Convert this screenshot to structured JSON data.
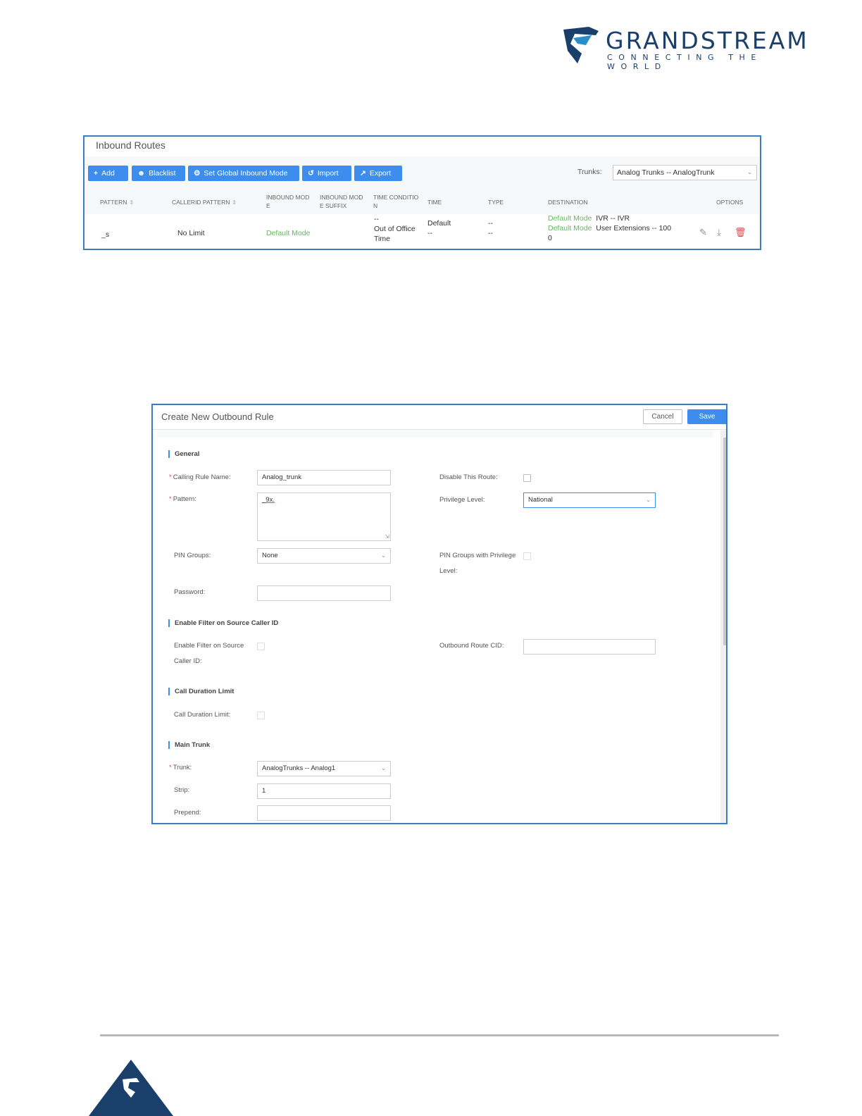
{
  "logo": {
    "name": "GRANDSTREAM",
    "tagline": "CONNECTING THE WORLD"
  },
  "inbound": {
    "title": "Inbound Routes",
    "buttons": {
      "add": "Add",
      "blacklist": "Blacklist",
      "global_mode": "Set Global Inbound Mode",
      "import": "Import",
      "export": "Export"
    },
    "trunks_label": "Trunks:",
    "trunks_value": "Analog Trunks -- AnalogTrunk",
    "columns": {
      "pattern": "PATTERN",
      "callerid": "CALLERID PATTERN",
      "inbound_mode_1": "INBOUND MOD",
      "inbound_mode_2": "E",
      "suffix_1": "INBOUND MOD",
      "suffix_2": "E SUFFIX",
      "time_cond_1": "TIME CONDITIO",
      "time_cond_2": "N",
      "time": "TIME",
      "type": "TYPE",
      "destination": "DESTINATION",
      "options": "OPTIONS"
    },
    "row": {
      "pattern": "_s",
      "callerid": "No Limit",
      "mode": "Default Mode",
      "time_cond_1": "--",
      "time_cond_2": "Out of Office",
      "time_cond_3": "Time",
      "time_1": "Default",
      "time_2": "--",
      "type_1": "--",
      "type_2": "--",
      "dest_mode_1": "Default Mode",
      "dest_value_1": "IVR -- IVR",
      "dest_mode_2": "Default Mode",
      "dest_value_2": "User Extensions -- 100",
      "dest_value_3": "0"
    }
  },
  "outbound": {
    "title": "Create New Outbound Rule",
    "cancel": "Cancel",
    "save": "Save",
    "sections": {
      "general": "General",
      "filter": "Enable Filter on Source Caller ID",
      "duration": "Call Duration Limit",
      "main_trunk": "Main Trunk"
    },
    "labels": {
      "calling_rule_name": "Calling Rule Name:",
      "pattern": "Pattern:",
      "pin_groups": "PIN Groups:",
      "password": "Password:",
      "disable_route": "Disable This Route:",
      "privilege": "Privilege Level:",
      "pin_priv_1": "PIN Groups with Privilege",
      "pin_priv_2": "Level:",
      "filter_1": "Enable Filter on Source",
      "filter_2": "Caller ID:",
      "route_cid": "Outbound Route CID:",
      "duration": "Call Duration Limit:",
      "trunk": "Trunk:",
      "strip": "Strip:",
      "prepend": "Prepend:"
    },
    "values": {
      "calling_rule_name": "Analog_trunk",
      "pattern": "_9x.",
      "pin_groups": "None",
      "password": "",
      "privilege": "National",
      "route_cid": "",
      "trunk": "AnalogTrunks -- Analog1",
      "strip": "1",
      "prepend": ""
    }
  },
  "colors": {
    "accent": "#3c8dee",
    "border": "#3c7cc4",
    "green": "#5bbf5b",
    "delete": "#e04848",
    "brand": "#1b3f6b"
  }
}
